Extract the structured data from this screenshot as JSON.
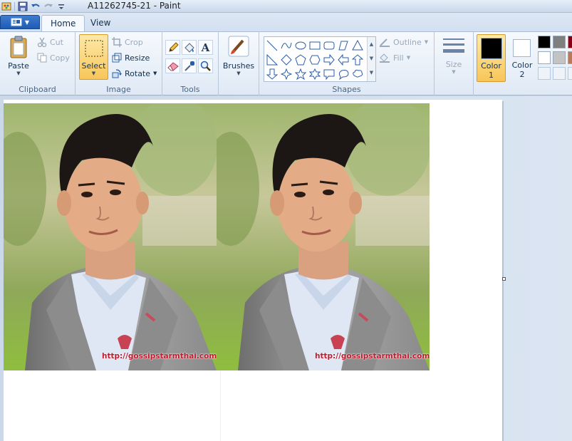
{
  "window": {
    "title": "A11262745-21 - Paint"
  },
  "tabs": [
    {
      "label": "Home"
    },
    {
      "label": "View"
    }
  ],
  "clipboard": {
    "paste_label": "Paste",
    "cut_label": "Cut",
    "copy_label": "Copy",
    "group_label": "Clipboard"
  },
  "image": {
    "select_label": "Select",
    "crop_label": "Crop",
    "resize_label": "Resize",
    "rotate_label": "Rotate",
    "group_label": "Image"
  },
  "tools": {
    "group_label": "Tools",
    "items": [
      "pencil-icon",
      "fill-icon",
      "text-icon",
      "eraser-icon",
      "color-picker-icon",
      "magnifier-icon"
    ]
  },
  "brushes": {
    "label": "Brushes"
  },
  "shapes": {
    "group_label": "Shapes",
    "outline_label": "Outline",
    "fill_label": "Fill"
  },
  "size": {
    "label": "Size"
  },
  "colors": {
    "color1_label": "Color",
    "color1_num": "1",
    "color2_label": "Color",
    "color2_num": "2",
    "color1_value": "#000000",
    "color2_value": "#ffffff",
    "palette": [
      "#000000",
      "#7f7f7f",
      "#880015",
      "#ffffff",
      "#c3c3c3",
      "#b97a57",
      "#ffffff",
      "#ffffff",
      "#ffffff"
    ]
  },
  "canvas": {
    "watermark_left": "http://gossipstarmthai.com",
    "watermark_right": "http://gossipstarmthai.com"
  }
}
